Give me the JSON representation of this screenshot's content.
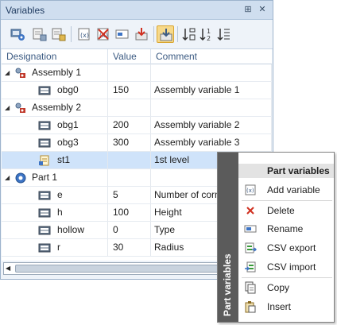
{
  "window": {
    "title": "Variables",
    "pin_glyph": "⊞",
    "close_glyph": "✕"
  },
  "toolbar": {
    "buttons": [
      {
        "name": "part-variables-icon"
      },
      {
        "name": "assembly-variables-icon"
      },
      {
        "name": "global-variables-icon"
      },
      {
        "name": "new-variable-icon"
      },
      {
        "name": "delete-variable-icon"
      },
      {
        "name": "rename-variable-icon"
      },
      {
        "name": "export-variable-icon"
      },
      {
        "name": "auto-update-icon",
        "active": true
      },
      {
        "name": "sort-ascending-icon"
      },
      {
        "name": "sort-descending-icon"
      },
      {
        "name": "sort-order-icon"
      }
    ]
  },
  "grid": {
    "columns": [
      "Designation",
      "Value",
      "Comment"
    ],
    "rows": [
      {
        "type": "group",
        "icon": "assembly-icon",
        "label": "Assembly 1",
        "value": "",
        "comment": ""
      },
      {
        "type": "var",
        "label": "obg0",
        "value": "150",
        "comment": "Assembly variable 1"
      },
      {
        "type": "group",
        "icon": "assembly-icon",
        "label": "Assembly 2",
        "value": "",
        "comment": ""
      },
      {
        "type": "var",
        "label": "obg1",
        "value": "200",
        "comment": "Assembly variable 2"
      },
      {
        "type": "var",
        "label": "obg3",
        "value": "300",
        "comment": "Assembly variable 3"
      },
      {
        "type": "doc",
        "label": "st1",
        "value": "",
        "comment": "1st level",
        "selected": true
      },
      {
        "type": "group",
        "icon": "part-icon",
        "label": "Part 1",
        "value": "",
        "comment": ""
      },
      {
        "type": "var",
        "label": "e",
        "value": "5",
        "comment": "Number of corn"
      },
      {
        "type": "var",
        "label": "h",
        "value": "100",
        "comment": "Height"
      },
      {
        "type": "var",
        "label": "hollow",
        "value": "0",
        "comment": "Type"
      },
      {
        "type": "var",
        "label": "r",
        "value": "30",
        "comment": "Radius"
      }
    ]
  },
  "context_menu": {
    "side_title": "Part variables",
    "header": "Part variables",
    "items": [
      {
        "label": "Add variable",
        "icon": "add-variable-icon"
      },
      {
        "label": "Delete",
        "icon": "delete-x-icon"
      },
      {
        "label": "Rename",
        "icon": "rename-icon"
      },
      {
        "label": "CSV export",
        "icon": "csv-export-icon"
      },
      {
        "label": "CSV import",
        "icon": "csv-import-icon"
      },
      {
        "label": "Copy",
        "icon": "copy-icon"
      },
      {
        "label": "Insert",
        "icon": "insert-icon"
      }
    ]
  },
  "scrollbar": {
    "left_arrow": "◀"
  },
  "colors": {
    "selection": "#cfe3fa",
    "header_text": "#3b5a82",
    "title_bar": "#cfdeef",
    "active_button": "#f7d98a",
    "menu_strip": "#5b5b5b"
  }
}
